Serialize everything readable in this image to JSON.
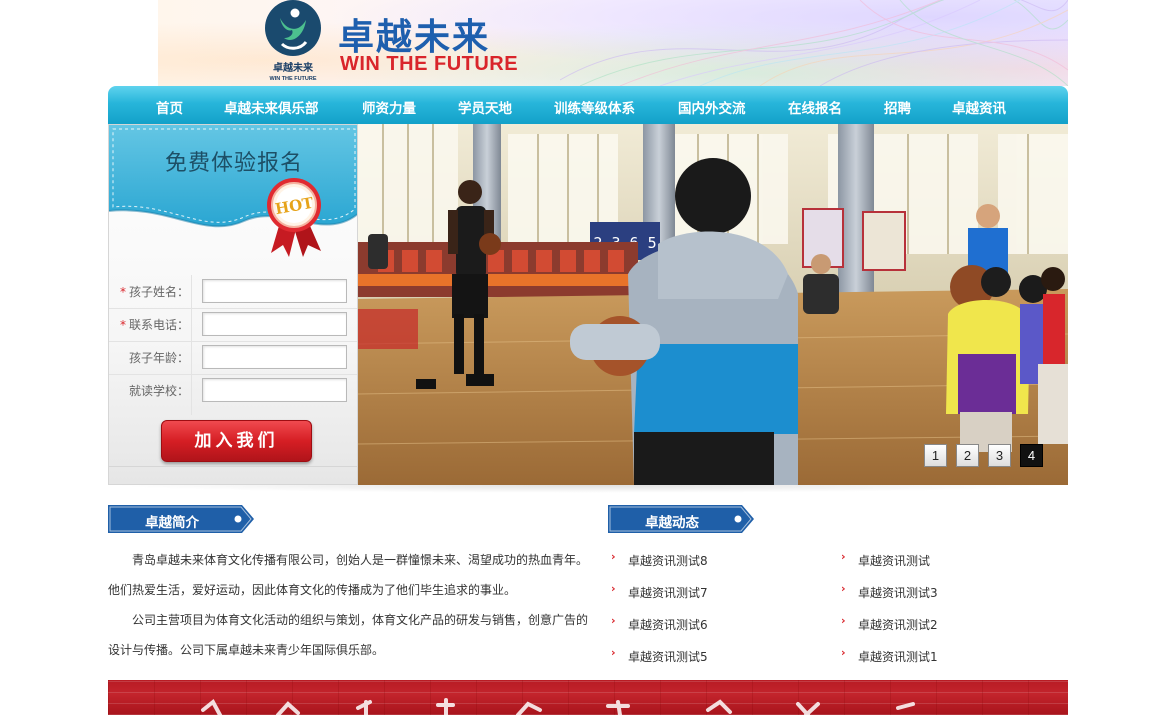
{
  "brand": {
    "name_cn": "卓越未来",
    "name_en": "WIN THE FUTURE",
    "mark_cn": "卓越未来",
    "mark_en": "WIN THE FUTURE",
    "primary_color": "#1e5fae",
    "accent_color": "#d9252b"
  },
  "nav": {
    "items": [
      {
        "label": "首页"
      },
      {
        "label": "卓越未来俱乐部"
      },
      {
        "label": "师资力量"
      },
      {
        "label": "学员天地"
      },
      {
        "label": "训练等级体系"
      },
      {
        "label": "国内外交流"
      },
      {
        "label": "在线报名"
      },
      {
        "label": "招聘"
      },
      {
        "label": "卓越资讯"
      }
    ],
    "color": "#27b5da"
  },
  "signup": {
    "title": "免费体验报名",
    "badge": "HOT",
    "fields": [
      {
        "label": "孩子姓名：",
        "required": true,
        "value": ""
      },
      {
        "label": "联系电话：",
        "required": true,
        "value": ""
      },
      {
        "label": "孩子年龄：",
        "required": false,
        "value": ""
      },
      {
        "label": "就读学校：",
        "required": false,
        "value": ""
      }
    ],
    "required_mark": "*",
    "submit_label": "加入我们"
  },
  "slideshow": {
    "pages": [
      "1",
      "2",
      "3",
      "4"
    ],
    "active_page": "4",
    "scoreboard_digits": "2 3 6 5"
  },
  "intro": {
    "title": "卓越简介",
    "paragraphs": [
      "青岛卓越未来体育文化传播有限公司，创始人是一群憧憬未来、渴望成功的热血青年。他们热爱生活，爱好运动，因此体育文化的传播成为了他们毕生追求的事业。",
      "公司主营项目为体育文化活动的组织与策划，体育文化产品的研发与销售，创意广告的设计与传播。公司下属卓越未来青少年国际俱乐部。"
    ]
  },
  "news": {
    "title": "卓越动态",
    "arrow": "›",
    "left": [
      "卓越资讯测试8",
      "卓越资讯测试7",
      "卓越资讯测试6",
      "卓越资讯测试5"
    ],
    "right": [
      "卓越资讯测试",
      "卓越资讯测试3",
      "卓越资讯测试2",
      "卓越资讯测试1"
    ]
  },
  "footer": {
    "banner_color": "#b81b24"
  }
}
